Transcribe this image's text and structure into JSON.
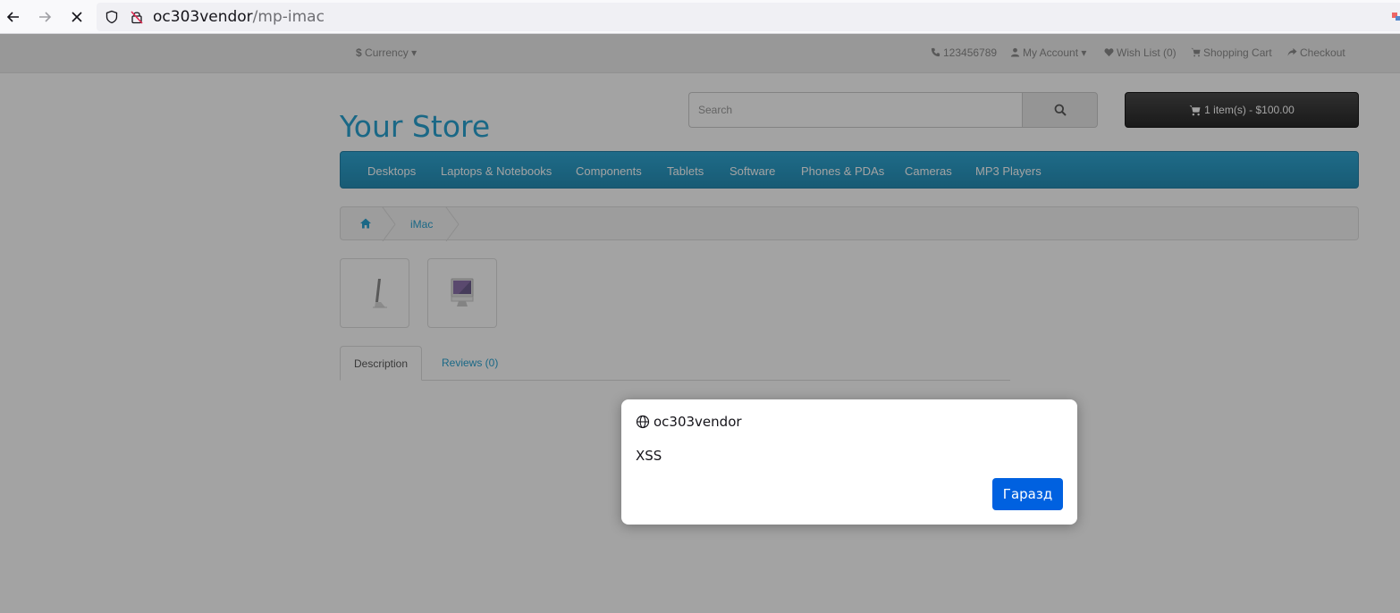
{
  "browser": {
    "url_host": "oc303vendor",
    "url_path": "/mp-imac"
  },
  "topbar": {
    "currency_label": "Currency",
    "currency_symbol": "$",
    "phone": "123456789",
    "my_account": "My Account",
    "wish_list": "Wish List (0)",
    "shopping_cart": "Shopping Cart",
    "checkout": "Checkout"
  },
  "header": {
    "store_name": "Your Store",
    "search_placeholder": "Search",
    "cart_summary": "1 item(s) - $100.00"
  },
  "menu": {
    "items": [
      "Desktops",
      "Laptops & Notebooks",
      "Components",
      "Tablets",
      "Software",
      "Phones & PDAs",
      "Cameras",
      "MP3 Players"
    ]
  },
  "breadcrumb": {
    "current": "iMac"
  },
  "tabs": {
    "description": "Description",
    "reviews": "Reviews (0)"
  },
  "dialog": {
    "origin": "oc303vendor",
    "message": "XSS",
    "ok_label": "Гаразд"
  },
  "colors": {
    "link": "#23a1d1",
    "menu": "#229ac8",
    "dialog_button": "#0061e0"
  }
}
